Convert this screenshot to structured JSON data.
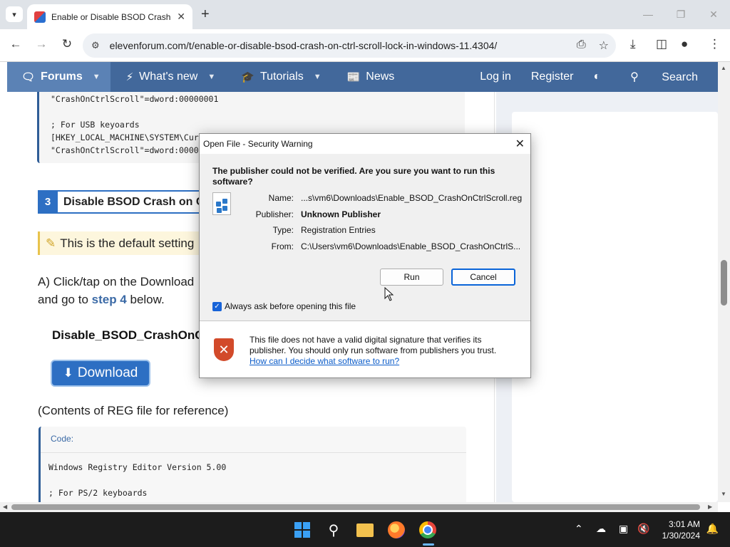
{
  "browser": {
    "tab_title": "Enable or Disable BSOD Crash o",
    "url": "elevenforum.com/t/enable-or-disable-bsod-crash-on-ctrl-scroll-lock-in-windows-11.4304/"
  },
  "sitenav": {
    "forums": "Forums",
    "whats_new": "What's new",
    "tutorials": "Tutorials",
    "news": "News",
    "login": "Log in",
    "register": "Register",
    "search": "Search"
  },
  "top_code": {
    "line1": "\"CrashOnCtrlScroll\"=dword:00000001",
    "line2": "; For USB keyoards",
    "line3": "[HKEY_LOCAL_MACHINE\\SYSTEM\\Cur",
    "line4": "\"CrashOnCtrlScroll\"=dword:0000"
  },
  "step": {
    "number": "3",
    "title": "Disable BSOD Crash on Ct"
  },
  "note": {
    "text": "This is the default setting"
  },
  "instructions": {
    "line1": "A) Click/tap on the Download",
    "line2_pre": "and go to ",
    "line2_link": "step 4",
    "line2_post": " below."
  },
  "file_heading": "Disable_BSOD_CrashOnC",
  "download_label": "Download",
  "contents_note": "(Contents of REG file for reference)",
  "code_block": {
    "label": "Code:",
    "line1": "Windows Registry Editor Version 5.00",
    "line2": "; For PS/2 keyboards"
  },
  "dialog": {
    "title": "Open File - Security Warning",
    "question": "The publisher could not be verified.  Are you sure you want to run this software?",
    "fields": [
      {
        "label": "Name:",
        "value": "...s\\vm6\\Downloads\\Enable_BSOD_CrashOnCtrlScroll.reg",
        "bold": false
      },
      {
        "label": "Publisher:",
        "value": "Unknown Publisher",
        "bold": true
      },
      {
        "label": "Type:",
        "value": "Registration Entries",
        "bold": false
      },
      {
        "label": "From:",
        "value": "C:\\Users\\vm6\\Downloads\\Enable_BSOD_CrashOnCtrlS...",
        "bold": false
      }
    ],
    "run_label": "Run",
    "cancel_label": "Cancel",
    "checkbox_label": "Always ask before opening this file",
    "checkbox_checked": true,
    "footer_text": "This file does not have a valid digital signature that verifies its publisher.  You should only run software from publishers you trust.",
    "footer_link": "How can I decide what software to run?"
  },
  "taskbar": {
    "time": "3:01 AM",
    "date": "1/30/2024"
  },
  "colors": {
    "nav_bg": "#42689b",
    "accent": "#2d6fc3",
    "dialog_focus": "#0a64d8"
  }
}
